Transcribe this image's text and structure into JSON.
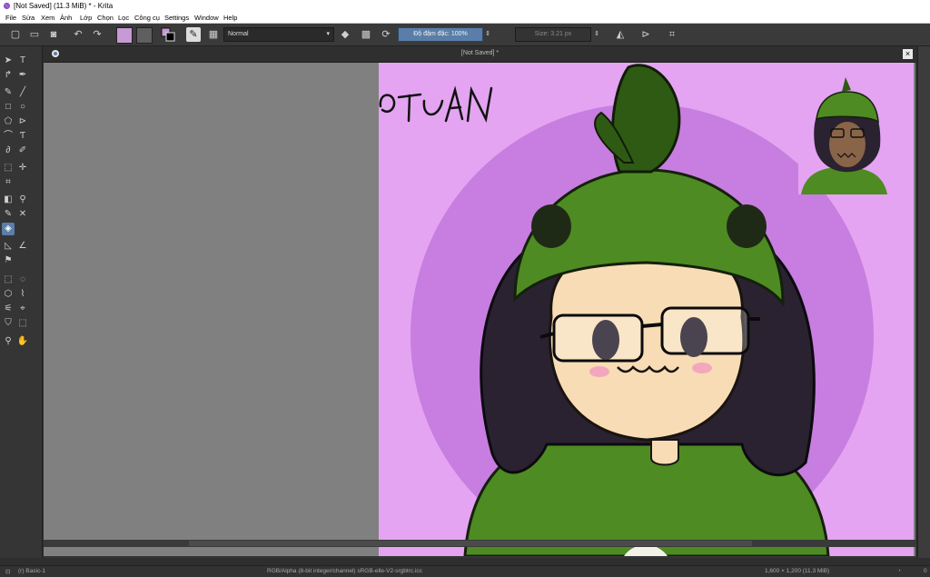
{
  "window": {
    "title": "[Not Saved]  (11.3 MiB)  * - Krita"
  },
  "menu": [
    "File",
    "Sửa",
    "Xem",
    "Ảnh",
    "Lớp",
    "Chọn",
    "Lọc",
    "Công cụ",
    "Settings",
    "Window",
    "Help"
  ],
  "toolbar": {
    "blend_mode": "Normal",
    "opacity_label": "Độ đậm đặc: 100%",
    "size_label": "Size: 3.21 px",
    "foreground_color": "#c79ad6",
    "background_color": "#5f5f5f"
  },
  "document": {
    "tab_title": "[Not Saved]  *",
    "watermark": "@TUAN"
  },
  "statusbar": {
    "layer": "(r) Basic-1",
    "color_space": "RGB/Alpha (8-bit integer/channel)  sRGB-elle-V2-srgbtrc.icc",
    "dimensions": "1,600 × 1,200 (11.3 MiB)",
    "zoom": "0"
  },
  "colors": {
    "accent": "#5a7ea8",
    "canvas_bg": "#808080",
    "art_bg": "#e4a4f2",
    "circle": "#c77ee0",
    "hat_green": "#4e8b23",
    "hair": "#2a2230",
    "skin": "#f7dcb5"
  }
}
